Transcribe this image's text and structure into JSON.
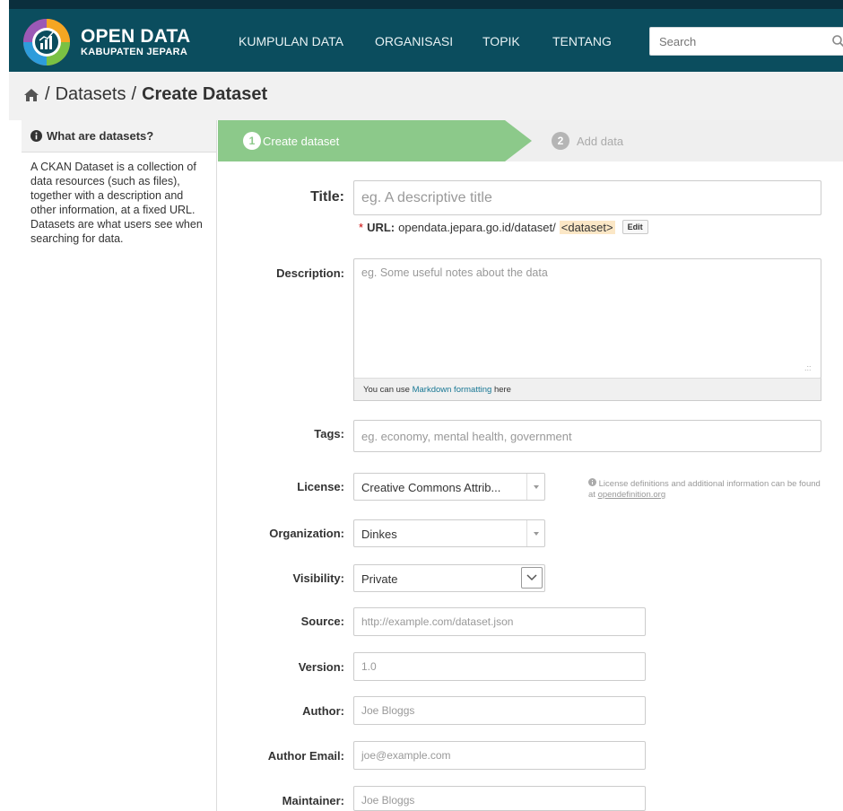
{
  "colors": {
    "navbar": "#0b4d5e",
    "stage_active": "#8cc98a",
    "link": "#187794"
  },
  "brand": {
    "title": "OPEN DATA",
    "subtitle": "KABUPATEN JEPARA"
  },
  "nav": {
    "items": [
      {
        "label": "KUMPULAN DATA"
      },
      {
        "label": "ORGANISASI"
      },
      {
        "label": "TOPIK"
      },
      {
        "label": "TENTANG"
      }
    ],
    "search_placeholder": "Search"
  },
  "breadcrumb": {
    "home_icon": "home-icon",
    "separator": "/",
    "item1": "Datasets",
    "current": "Create Dataset"
  },
  "sidebar": {
    "heading": "What are datasets?",
    "text": "A CKAN Dataset is a collection of data resources (such as files), together with a description and other information, at a fixed URL. Datasets are what users see when searching for data."
  },
  "stages": [
    {
      "number": "1",
      "label": "Create dataset",
      "active": true
    },
    {
      "number": "2",
      "label": "Add data",
      "active": false
    }
  ],
  "form": {
    "title": {
      "label": "Title:",
      "placeholder": "eg. A descriptive title"
    },
    "url": {
      "prefix": "URL:",
      "base": "opendata.jepara.go.id/dataset/",
      "token": "<dataset>",
      "edit_label": "Edit"
    },
    "description": {
      "label": "Description:",
      "placeholder": "eg. Some useful notes about the data",
      "hint_prefix": "You can use",
      "hint_link": "Markdown formatting",
      "hint_suffix": "here"
    },
    "tags": {
      "label": "Tags:",
      "placeholder": "eg. economy, mental health, government"
    },
    "license": {
      "label": "License:",
      "value": "Creative Commons Attrib...",
      "help_text": "License definitions and additional information can be found at",
      "help_link": "opendefinition.org"
    },
    "organization": {
      "label": "Organization:",
      "value": "Dinkes"
    },
    "visibility": {
      "label": "Visibility:",
      "value": "Private"
    },
    "source": {
      "label": "Source:",
      "placeholder": "http://example.com/dataset.json"
    },
    "version": {
      "label": "Version:",
      "placeholder": "1.0"
    },
    "author": {
      "label": "Author:",
      "placeholder": "Joe Bloggs"
    },
    "author_email": {
      "label": "Author Email:",
      "placeholder": "joe@example.com"
    },
    "maintainer": {
      "label": "Maintainer:",
      "placeholder": "Joe Bloggs"
    }
  }
}
